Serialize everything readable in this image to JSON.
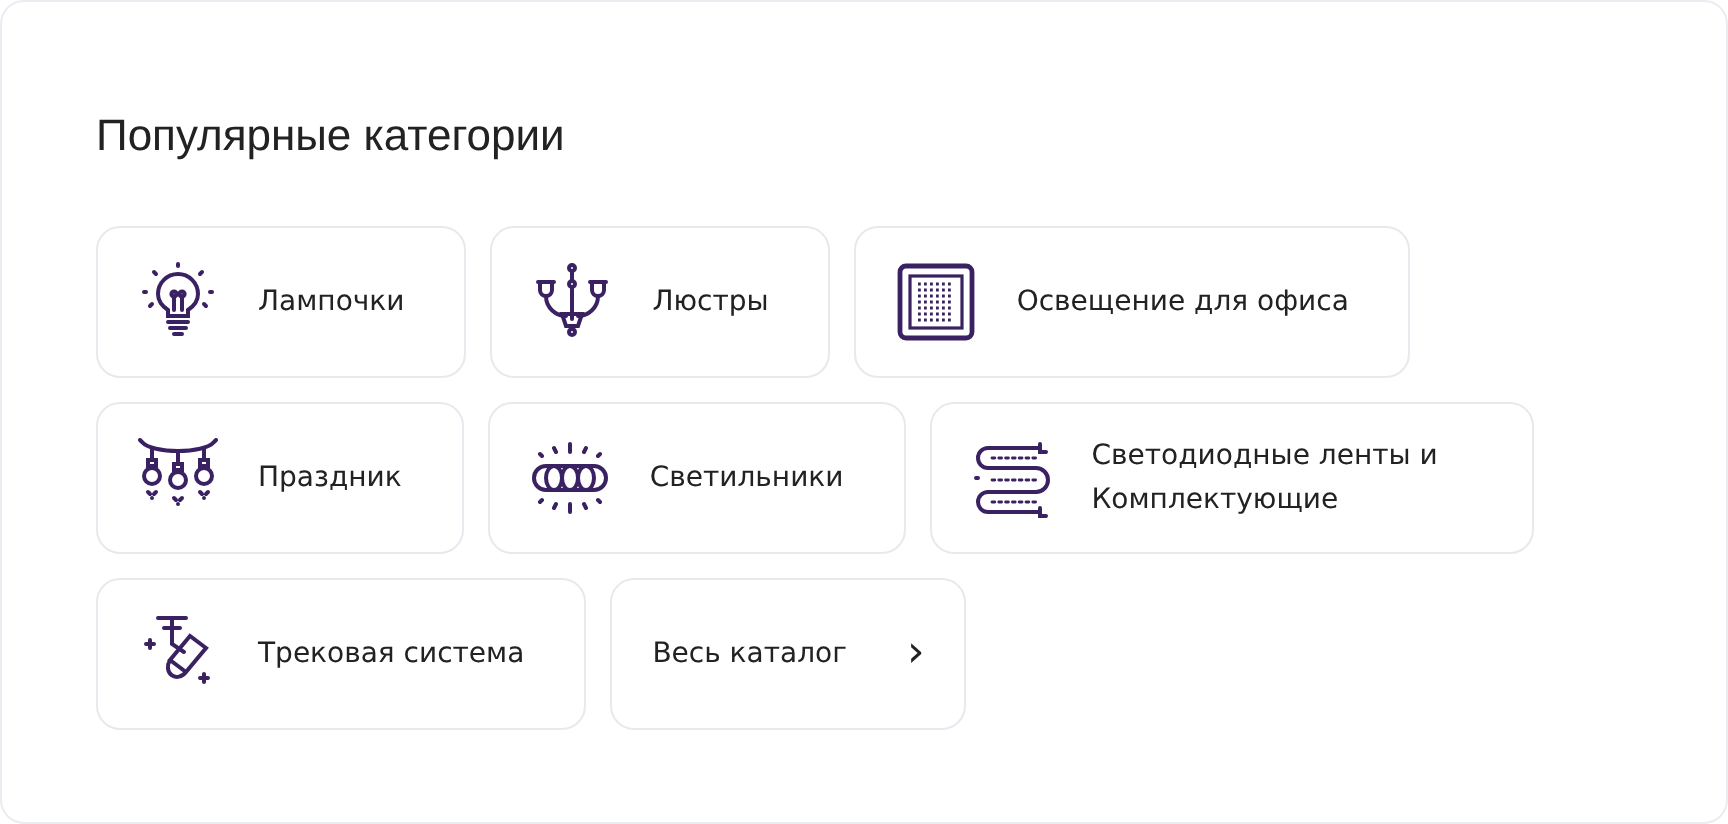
{
  "title": "Популярные категории",
  "rows": [
    [
      {
        "kind": "bulb",
        "label": "Лампочки"
      },
      {
        "kind": "chandelier",
        "label": "Люстры"
      },
      {
        "kind": "panel",
        "label": "Освещение для офиса"
      }
    ],
    [
      {
        "kind": "garland",
        "label": "Праздник"
      },
      {
        "kind": "ring",
        "label": "Светильники"
      },
      {
        "kind": "strip",
        "label": "Светодиодные ленты и Комплектующие"
      }
    ],
    [
      {
        "kind": "track",
        "label": "Трековая система"
      },
      {
        "kind": "catalog",
        "label": "Весь каталог",
        "chevron": "›"
      }
    ]
  ]
}
